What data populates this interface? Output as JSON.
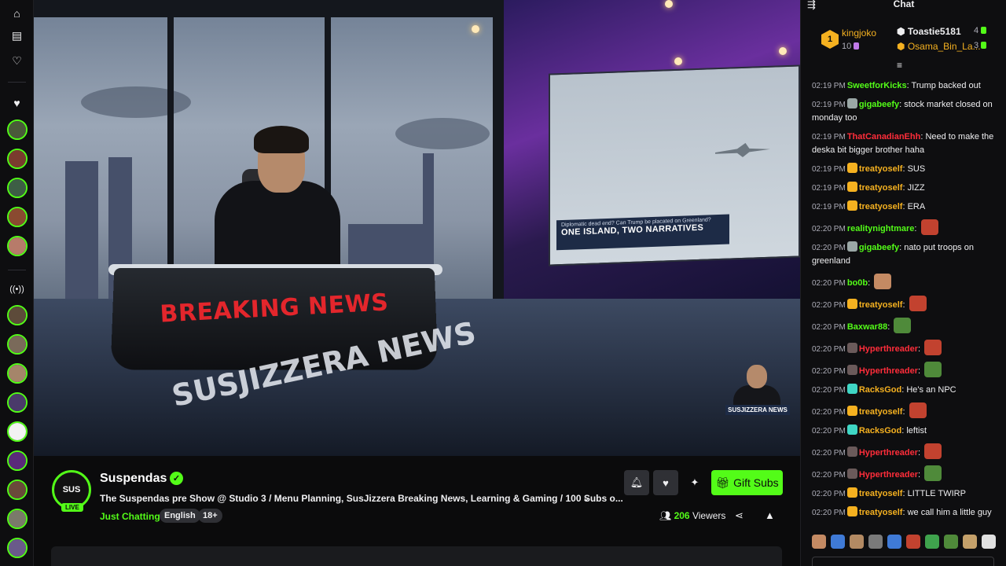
{
  "rail": {
    "avatar_colors": [
      "#4a5a3a",
      "#7a3b2e",
      "#3d5e45",
      "#8a4a30",
      "#b77b6a",
      "#5d4b3a",
      "#7a6a5a",
      "#a5856a",
      "#4a3a6a",
      "#f2f2f2",
      "#5a2a7a",
      "#6a4a3a",
      "#7a7a6a",
      "#6a5a8a"
    ]
  },
  "video": {
    "desk_text": "BREAKING NEWS",
    "monitor_small": "Diplomatic dead end? Can Trump be placated on Greenland?",
    "monitor_big": "ONE ISLAND, TWO NARRATIVES",
    "floor_logo": "SUSJIZZERA NEWS",
    "mini_cam_tag": "SUSJIZZERA NEWS"
  },
  "channel": {
    "avatar_text": "SUS",
    "live_label": "LIVE",
    "name": "Suspendas",
    "title": "The Suspendas pre Show @ Studio 3 / Menu Planning, SusJizzera Breaking News, Learning & Gaming / 100 Subs o...",
    "category": "Just Chatting",
    "tags": [
      "English",
      "18+"
    ],
    "viewers_count": "206",
    "viewers_label": "Viewers",
    "gift_label": "Gift Subs",
    "accent": "#53fc18"
  },
  "chat": {
    "title": "Chat",
    "leaderboard": {
      "first": {
        "rank": "1",
        "name": "kingjoko",
        "count": "10"
      },
      "second": {
        "name": "Toastie5181",
        "count": "4"
      },
      "third": {
        "name": "Osama_Bin_La...",
        "count": "3"
      }
    },
    "messages": [
      {
        "ts": "02:19 PM",
        "user": "SweetforKicks",
        "color": "#53fc18",
        "text": "Trump backed out",
        "badge": "",
        "emote": ""
      },
      {
        "ts": "02:19 PM",
        "user": "gigabeefy",
        "color": "#53fc18",
        "text": "stock market closed on monday too",
        "badge": "#9aa7a6",
        "emote": ""
      },
      {
        "ts": "02:19 PM",
        "user": "ThatCanadianEhh",
        "color": "#ff2d3a",
        "text": "Need to make the deska bit bigger brother haha",
        "badge": "",
        "emote": ""
      },
      {
        "ts": "02:19 PM",
        "user": "treatyoself",
        "color": "#f5b120",
        "text": "SUS",
        "badge": "#f5b120",
        "emote": ""
      },
      {
        "ts": "02:19 PM",
        "user": "treatyoself",
        "color": "#f5b120",
        "text": "JIZZ",
        "badge": "#f5b120",
        "emote": ""
      },
      {
        "ts": "02:19 PM",
        "user": "treatyoself",
        "color": "#f5b120",
        "text": "ERA",
        "badge": "#f5b120",
        "emote": ""
      },
      {
        "ts": "02:20 PM",
        "user": "realitynightmare",
        "color": "#53fc18",
        "text": "",
        "badge": "",
        "emote": "#c2422f"
      },
      {
        "ts": "02:20 PM",
        "user": "gigabeefy",
        "color": "#53fc18",
        "text": "nato put troops on greenland",
        "badge": "#9aa7a6",
        "emote": ""
      },
      {
        "ts": "02:20 PM",
        "user": "bo0b",
        "color": "#53fc18",
        "text": "",
        "badge": "",
        "emote": "#c48a63"
      },
      {
        "ts": "02:20 PM",
        "user": "treatyoself",
        "color": "#f5b120",
        "text": "",
        "badge": "#f5b120",
        "emote": "#c2422f"
      },
      {
        "ts": "02:20 PM",
        "user": "Baxwar88",
        "color": "#53fc18",
        "text": "",
        "badge": "",
        "emote": "#4f8a3a"
      },
      {
        "ts": "02:20 PM",
        "user": "Hyperthreader",
        "color": "#ff2d3a",
        "text": "",
        "badge": "#6a5a5a",
        "emote": "#c2422f"
      },
      {
        "ts": "02:20 PM",
        "user": "Hyperthreader",
        "color": "#ff2d3a",
        "text": "",
        "badge": "#6a5a5a",
        "emote": "#4f8a3a"
      },
      {
        "ts": "02:20 PM",
        "user": "RacksGod",
        "color": "#f5b120",
        "text": "He's an NPC",
        "badge": "#3fd6c4",
        "emote": ""
      },
      {
        "ts": "02:20 PM",
        "user": "treatyoself",
        "color": "#f5b120",
        "text": "",
        "badge": "#f5b120",
        "emote": "#c2422f"
      },
      {
        "ts": "02:20 PM",
        "user": "RacksGod",
        "color": "#f5b120",
        "text": "leftist",
        "badge": "#3fd6c4",
        "emote": ""
      },
      {
        "ts": "02:20 PM",
        "user": "Hyperthreader",
        "color": "#ff2d3a",
        "text": "",
        "badge": "#6a5a5a",
        "emote": "#c2422f"
      },
      {
        "ts": "02:20 PM",
        "user": "Hyperthreader",
        "color": "#ff2d3a",
        "text": "",
        "badge": "#6a5a5a",
        "emote": "#4f8a3a"
      },
      {
        "ts": "02:20 PM",
        "user": "treatyoself",
        "color": "#f5b120",
        "text": "LITTLE TWIRP",
        "badge": "#f5b120",
        "emote": ""
      },
      {
        "ts": "02:20 PM",
        "user": "treatyoself",
        "color": "#f5b120",
        "text": "we call him a little guy",
        "badge": "#f5b120",
        "emote": ""
      }
    ],
    "emote_colors": [
      "#c48a63",
      "#3f7ad6",
      "#b38a63",
      "#7a7a7a",
      "#3f7ad6",
      "#c2422f",
      "#3fa34d",
      "#4f8a3a",
      "#c4a06a",
      "#e0e0e0"
    ]
  }
}
